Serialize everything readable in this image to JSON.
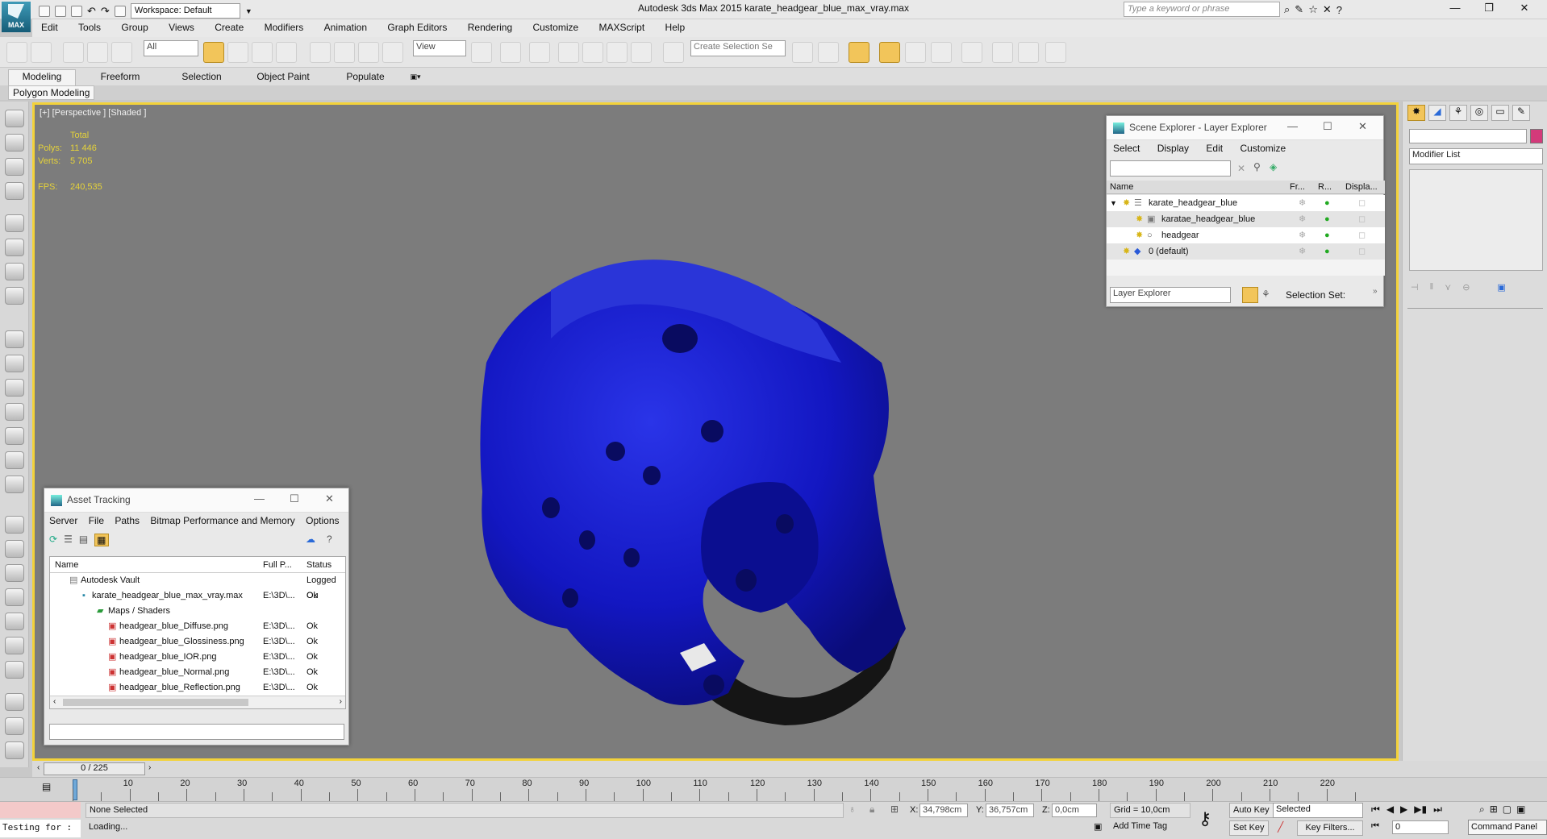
{
  "app": {
    "title": "Autodesk 3ds Max  2015    karate_headgear_blue_max_vray.max",
    "logo_text": "MAX",
    "workspace": "Workspace: Default",
    "search_placeholder": "Type a keyword or phrase"
  },
  "menu": [
    "Edit",
    "Tools",
    "Group",
    "Views",
    "Create",
    "Modifiers",
    "Animation",
    "Graph Editors",
    "Rendering",
    "Customize",
    "MAXScript",
    "Help"
  ],
  "toolbar": {
    "selection_filter": "All",
    "ref_coord": "View",
    "named_selection_placeholder": "Create Selection Se"
  },
  "ribbon": {
    "tabs": [
      "Modeling",
      "Freeform",
      "Selection",
      "Object Paint",
      "Populate"
    ],
    "sub_label": "Polygon Modeling"
  },
  "viewport": {
    "label": "[+] [Perspective ] [Shaded ]",
    "stats": {
      "total_label": "Total",
      "polys_label": "Polys:",
      "polys": "11 446",
      "verts_label": "Verts:",
      "verts": "5 705",
      "fps_label": "FPS:",
      "fps": "240,535"
    }
  },
  "scene_explorer": {
    "title": "Scene Explorer - Layer Explorer",
    "menu": [
      "Select",
      "Display",
      "Edit",
      "Customize"
    ],
    "columns": [
      "Name",
      "Fr...",
      "R...",
      "Displa..."
    ],
    "rows": [
      {
        "name": "karate_headgear_blue"
      },
      {
        "name": "karatae_headgear_blue"
      },
      {
        "name": "headgear"
      },
      {
        "name": "0 (default)"
      }
    ],
    "footer_dropdown": "Layer Explorer",
    "selection_set_label": "Selection Set:"
  },
  "asset_tracking": {
    "title": "Asset Tracking",
    "menu": [
      "Server",
      "File",
      "Paths",
      "Bitmap Performance and Memory",
      "Options"
    ],
    "columns": [
      "Name",
      "Full P...",
      "Status"
    ],
    "rows": [
      {
        "name": "Autodesk Vault",
        "path": "",
        "status": "Logged Ou"
      },
      {
        "name": "karate_headgear_blue_max_vray.max",
        "path": "E:\\3D\\...",
        "status": "Ok"
      },
      {
        "name": "Maps / Shaders",
        "path": "",
        "status": ""
      },
      {
        "name": "headgear_blue_Diffuse.png",
        "path": "E:\\3D\\...",
        "status": "Ok"
      },
      {
        "name": "headgear_blue_Glossiness.png",
        "path": "E:\\3D\\...",
        "status": "Ok"
      },
      {
        "name": "headgear_blue_IOR.png",
        "path": "E:\\3D\\...",
        "status": "Ok"
      },
      {
        "name": "headgear_blue_Normal.png",
        "path": "E:\\3D\\...",
        "status": "Ok"
      },
      {
        "name": "headgear_blue_Reflection.png",
        "path": "E:\\3D\\...",
        "status": "Ok"
      }
    ]
  },
  "command_panel": {
    "modifier_list": "Modifier List",
    "tooltip": "Command Panel",
    "swatch_color": "#d33a7a"
  },
  "timeline": {
    "frame_counter": "0 / 225",
    "ticks": [
      "10",
      "20",
      "30",
      "40",
      "50",
      "60",
      "70",
      "80",
      "90",
      "100",
      "110",
      "120",
      "130",
      "140",
      "150",
      "160",
      "170",
      "180",
      "190",
      "200",
      "210",
      "220"
    ]
  },
  "status": {
    "selection": "None Selected",
    "loading": "Loading...",
    "script_listener": "Testing for :",
    "x_label": "X:",
    "x": "34,798cm",
    "y_label": "Y:",
    "y": "36,757cm",
    "z_label": "Z:",
    "z": "0,0cm",
    "grid": "Grid = 10,0cm",
    "add_time_tag": "Add Time Tag",
    "auto_key": "Auto Key",
    "set_key": "Set Key",
    "key_mode": "Selected",
    "key_filters": "Key Filters...",
    "frame": "0"
  },
  "colors": {
    "viewport_border": "#f3d23a",
    "viewport_bg": "#7c7c7c",
    "model_blue": "#1418c4",
    "stats_text": "#e5d23a"
  }
}
